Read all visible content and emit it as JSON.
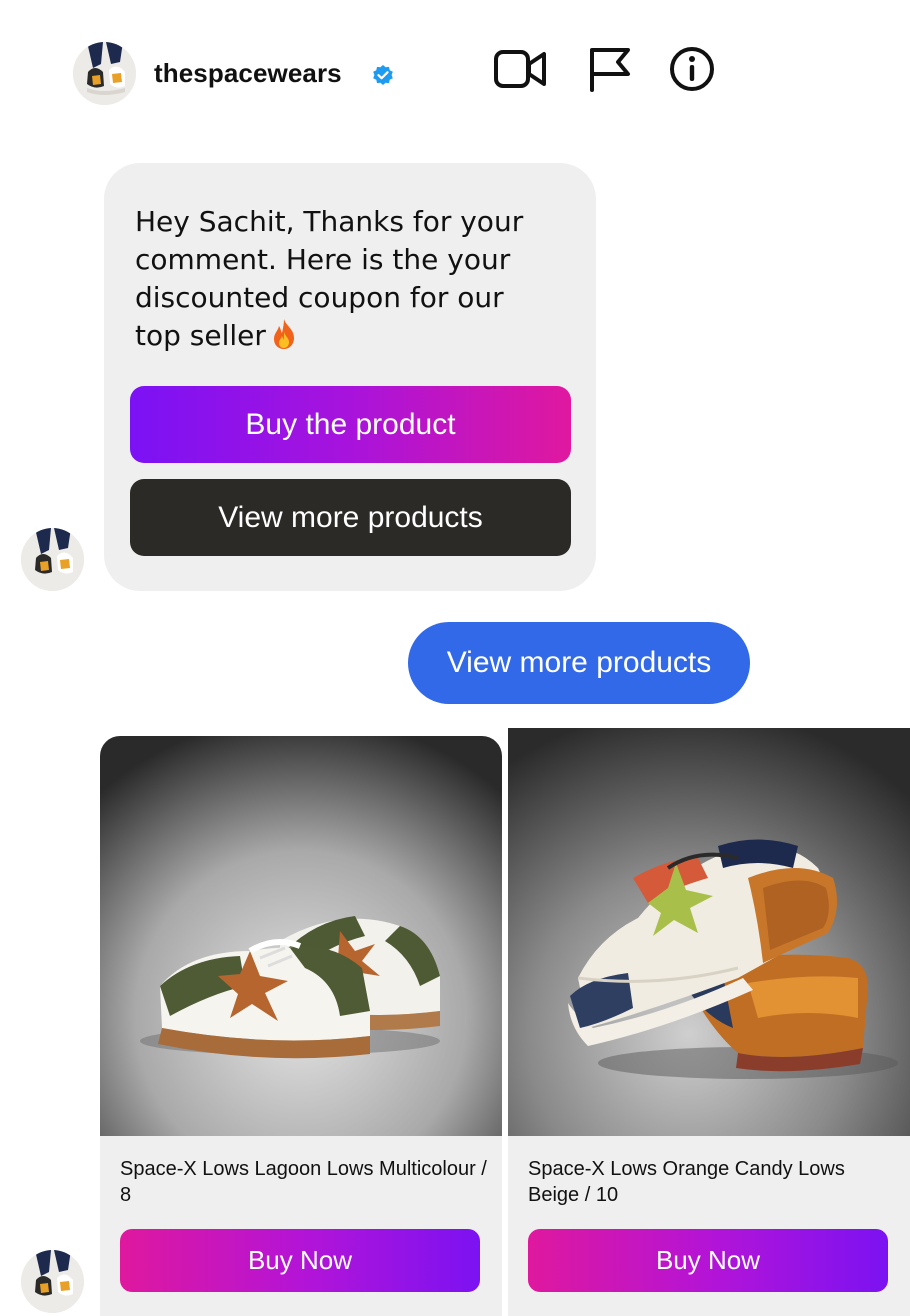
{
  "header": {
    "username": "thespacewears",
    "verified": true,
    "icons": [
      "video-call-icon",
      "flag-icon",
      "info-icon"
    ]
  },
  "messages": {
    "incoming": {
      "text": "Hey Sachit, Thanks for your comment. Here is the your discounted coupon for our top seller",
      "emoji": "fire-icon",
      "buttons": {
        "buy_label": "Buy the product",
        "view_label": "View more products"
      }
    },
    "outgoing": {
      "text": "View more products"
    }
  },
  "products": [
    {
      "name": "Space-X Lows Lagoon Lows Multicolour / 8",
      "button_label": "Buy Now"
    },
    {
      "name": "Space-X Lows Orange Candy Lows Beige / 10",
      "button_label": "Buy Now"
    }
  ],
  "colors": {
    "outgoing_bubble": "#3269e8",
    "incoming_bubble": "#efefef",
    "dark_button": "#2c2a26",
    "gradient_purple": "#7b12f5",
    "gradient_pink": "#e0189f",
    "verified_badge": "#1d9bf0"
  }
}
